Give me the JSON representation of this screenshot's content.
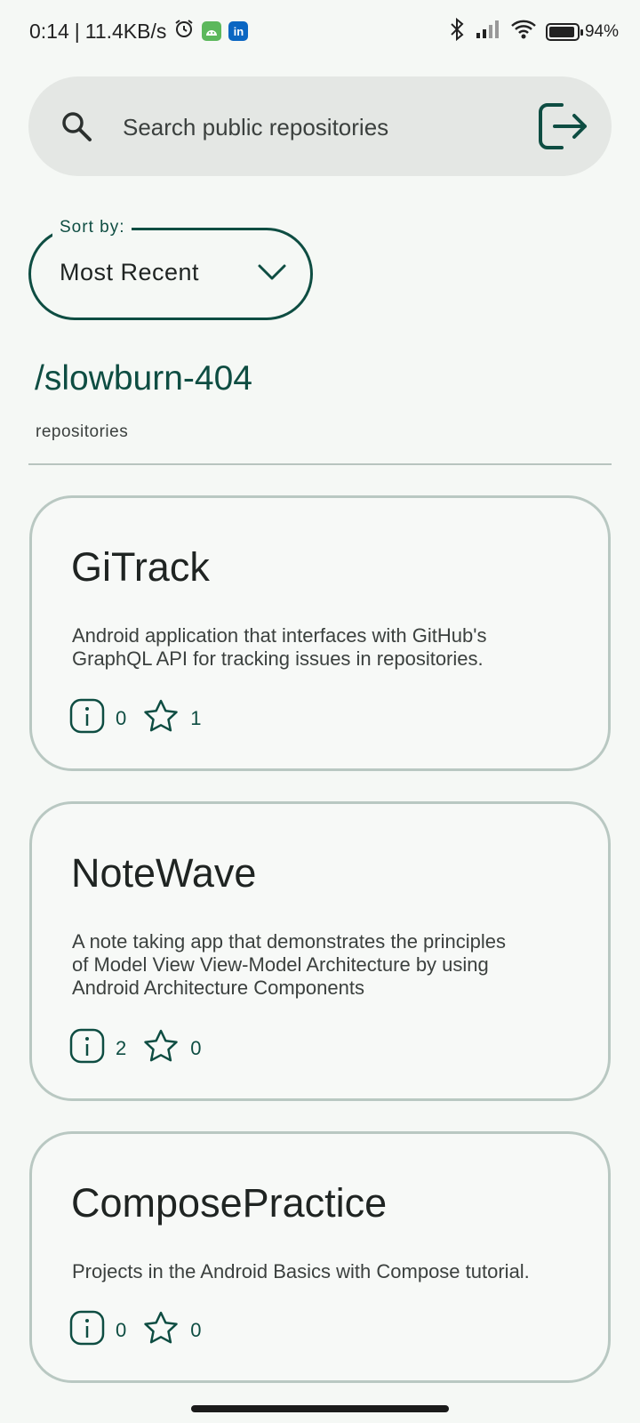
{
  "status_bar": {
    "time": "0:14",
    "speed": "11.4KB/s",
    "battery": "94%",
    "battery_level": 0.94,
    "alarm_icon": "alarm-icon",
    "app_icons": [
      "android-app-icon",
      "linkedin-icon"
    ],
    "linkedin_text": "in"
  },
  "search": {
    "placeholder": "Search public repositories",
    "value": ""
  },
  "sort": {
    "label": "Sort by:",
    "selected": "Most Recent"
  },
  "owner": {
    "name": "/slowburn-404",
    "subtitle": "repositories"
  },
  "repositories": [
    {
      "name": "GiTrack",
      "description_lines": [
        "Android application that interfaces with GitHub's",
        "GraphQL API for tracking issues in repositories."
      ],
      "issues": "0",
      "stars": "1"
    },
    {
      "name": "NoteWave",
      "description_lines": [
        "A note taking app that demonstrates the principles",
        "of Model View View-Model Architecture by using",
        "Android Architecture Components"
      ],
      "issues": "2",
      "stars": "0"
    },
    {
      "name": "ComposePractice",
      "description_lines": [
        "Projects in the Android Basics with Compose tutorial."
      ],
      "issues": "0",
      "stars": "0"
    }
  ],
  "colors": {
    "accent": "#0e4d42",
    "background": "#f5f8f5",
    "card_border": "#b9c8c2",
    "search_bg": "#e4e7e4"
  }
}
